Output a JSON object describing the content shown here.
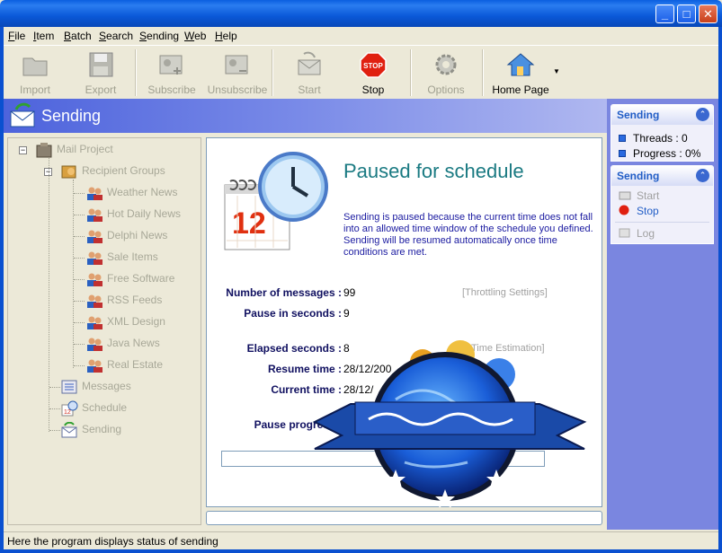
{
  "menu": {
    "file": {
      "u": "F",
      "rest": "ile"
    },
    "item": {
      "u": "I",
      "rest": "tem"
    },
    "batch": {
      "u": "B",
      "rest": "atch"
    },
    "search": {
      "u": "S",
      "rest": "earch"
    },
    "sending": {
      "u": "S",
      "rest": "ending"
    },
    "web": {
      "u": "W",
      "rest": "eb"
    },
    "help": {
      "u": "H",
      "rest": "elp"
    }
  },
  "toolbar": {
    "import": "Import",
    "export": "Export",
    "subscribe": "Subscribe",
    "unsubscribe": "Unsubscribe",
    "start": "Start",
    "stop": "Stop",
    "stop_sign": "STOP",
    "options": "Options",
    "home_page": "Home Page"
  },
  "header": {
    "title": "Sending"
  },
  "right_pane": {
    "status_box": {
      "title": "Sending",
      "threads": "Threads : 0",
      "progress": "Progress : 0%"
    },
    "actions_box": {
      "title": "Sending",
      "start": "Start",
      "stop": "Stop",
      "log": "Log"
    }
  },
  "tree": {
    "root": "Mail Project",
    "recipient_groups": "Recipient Groups",
    "groups": [
      "Weather News",
      "Hot Daily News",
      "Delphi News",
      "Sale Items",
      "Free Software",
      "RSS Feeds",
      "XML Design",
      "Java News",
      "Real Estate"
    ],
    "messages": "Messages",
    "schedule": "Schedule",
    "sending": "Sending"
  },
  "main": {
    "title": "Paused for schedule",
    "calendar_day": "12",
    "description": "Sending is paused because the current time does not fall into an allowed time window of the schedule you defined. Sending will be resumed automatically once time conditions are met.",
    "num_messages_label": "Number of messages :",
    "num_messages_value": "99",
    "throttling": "[Throttling Settings]",
    "pause_seconds_label": "Pause in seconds :",
    "pause_seconds_value": "9",
    "elapsed_label": "Elapsed seconds :",
    "elapsed_value": "8",
    "time_estimation": "Time Estimation]",
    "resume_label": "Resume time :",
    "resume_value": "28/12/200",
    "current_label": "Current time :",
    "current_value": "28/12/",
    "pause_progress_label": "Pause progress :",
    "pause_progress_value": "0"
  },
  "status_bar": {
    "text": "Here the program displays status of sending"
  },
  "colors": {
    "title_bar": "#0a58d8",
    "header_band": "#4d63dc",
    "accent_title": "#1a7a82",
    "task_pane": "#7a86e0"
  }
}
